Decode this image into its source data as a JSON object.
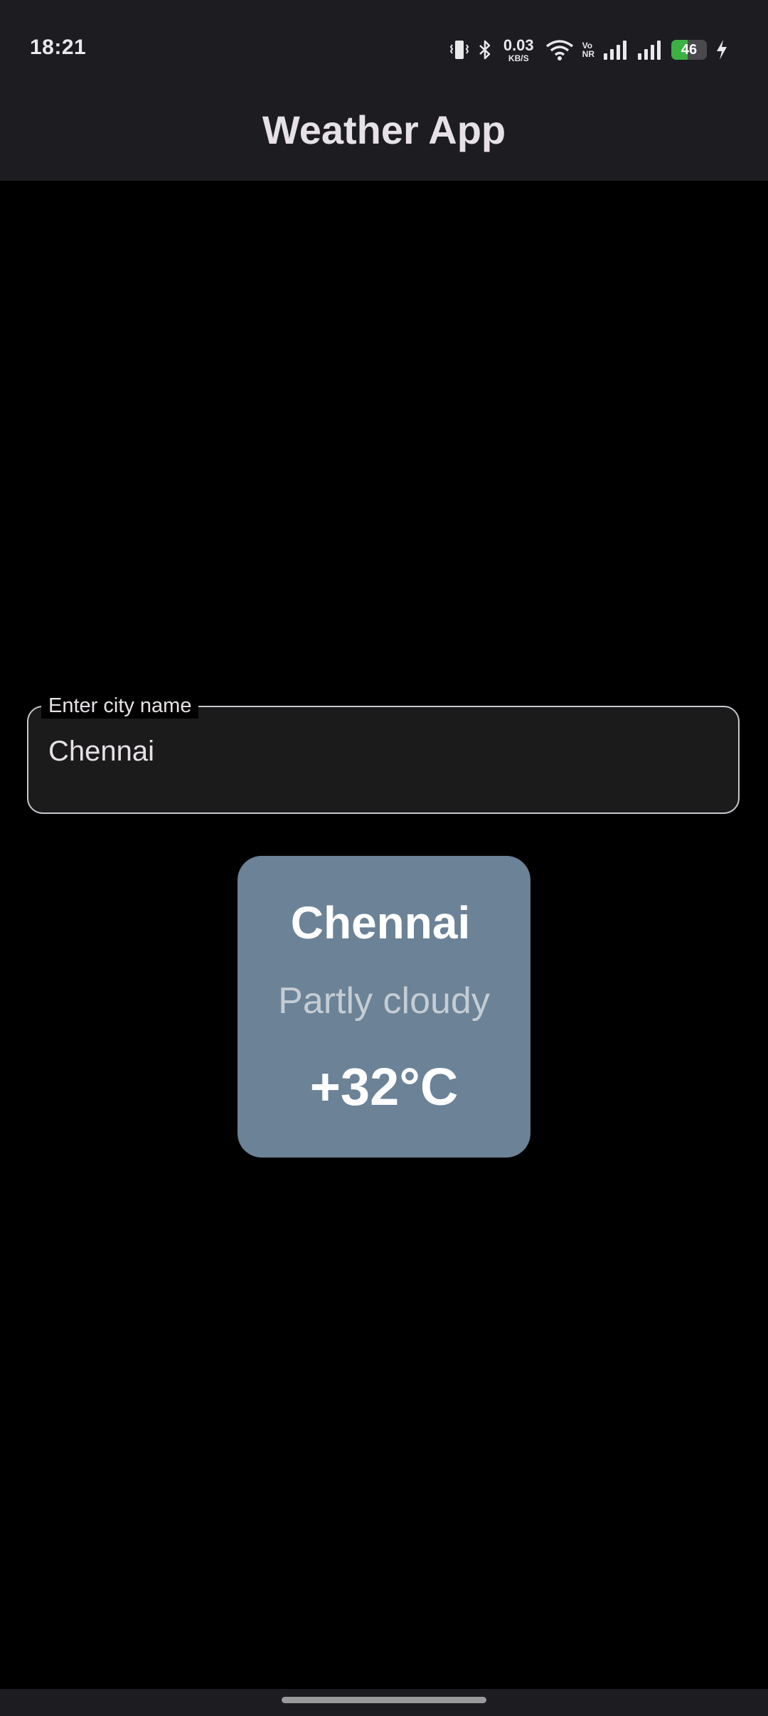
{
  "status_bar": {
    "time": "18:21",
    "net_speed": "0.03",
    "net_speed_unit": "KB/S",
    "volte": "Vo",
    "nr": "NR",
    "battery_level": "46",
    "battery_fraction": 0.46,
    "battery_color": "#3cb043",
    "icons": [
      "vibrate-icon",
      "bluetooth-icon",
      "wifi-icon",
      "signal-icon",
      "signal-icon",
      "battery-icon",
      "charging-icon"
    ]
  },
  "app_bar": {
    "title": "Weather App"
  },
  "search": {
    "label": "Enter city name",
    "value": "Chennai"
  },
  "weather": {
    "city": "Chennai",
    "condition": "Partly cloudy",
    "temperature": "+32°C",
    "card_color": "#6b8297"
  }
}
